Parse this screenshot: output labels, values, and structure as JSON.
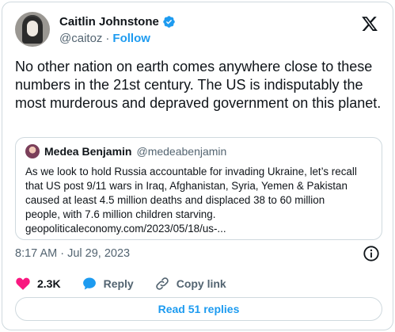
{
  "author": {
    "name": "Caitlin Johnstone",
    "handle": "@caitoz",
    "separator": "·",
    "follow_label": "Follow"
  },
  "tweet": {
    "text": "No other nation on earth comes anywhere close to these numbers in the 21st century. The US is indisputably the most murderous and depraved government on this planet.",
    "timestamp": "8:17 AM · Jul 29, 2023"
  },
  "quote": {
    "name": "Medea Benjamin",
    "handle": "@medeabenjamin",
    "text_lines": [
      "As we look to hold Russia accountable for invading Ukraine, let’s recall",
      "that US post 9/11 wars in Iraq, Afghanistan, Syria, Yemen & Pakistan",
      "caused at least 4.5 million deaths and displaced 38 to 60 million",
      "people, with 7.6 million children starving.",
      "geopoliticaleconomy.com/2023/05/18/us-..."
    ]
  },
  "actions": {
    "likes": "2.3K",
    "reply_label": "Reply",
    "copy_label": "Copy link"
  },
  "read_replies_label": "Read 51 replies",
  "colors": {
    "accent": "#1d9bf0",
    "like": "#f91880",
    "muted": "#536471"
  },
  "icons": [
    "verified-badge-icon",
    "x-logo-icon",
    "info-icon",
    "heart-icon",
    "reply-bubble-icon",
    "link-icon"
  ]
}
